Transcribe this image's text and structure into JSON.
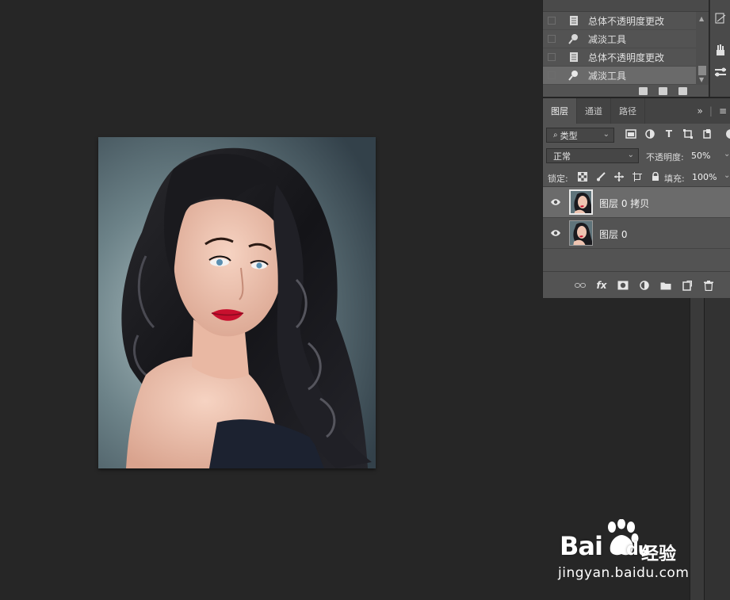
{
  "history": {
    "items": [
      {
        "label": "总体不透明度更改",
        "icon": "document-icon",
        "selected": false
      },
      {
        "label": "减淡工具",
        "icon": "dodge-tool-icon",
        "selected": false
      },
      {
        "label": "总体不透明度更改",
        "icon": "document-icon",
        "selected": false
      },
      {
        "label": "减淡工具",
        "icon": "dodge-tool-icon",
        "selected": true
      }
    ]
  },
  "layers_panel": {
    "tabs": [
      {
        "label": "图层",
        "active": true
      },
      {
        "label": "通道",
        "active": false
      },
      {
        "label": "路径",
        "active": false
      }
    ],
    "collapse_glyph": "»",
    "menu_glyph": "≡",
    "filter_kind": "类型",
    "blend_mode": "正常",
    "opacity_label": "不透明度:",
    "opacity_value": "50%",
    "lock_label": "锁定:",
    "fill_label": "填充:",
    "fill_value": "100%",
    "layers": [
      {
        "name": "图层 0 拷贝",
        "visible": true,
        "selected": true
      },
      {
        "name": "图层 0",
        "visible": true,
        "selected": false
      }
    ],
    "footer_fx": "fx"
  },
  "watermark": {
    "brand": "Bai",
    "brand_suffix": "du",
    "chinese": "经验",
    "url": "jingyan.baidu.com"
  },
  "colors": {
    "workspace": "#262626",
    "panel": "#535353",
    "selected_row": "#6b6b6b",
    "lips": "#c8102e"
  }
}
